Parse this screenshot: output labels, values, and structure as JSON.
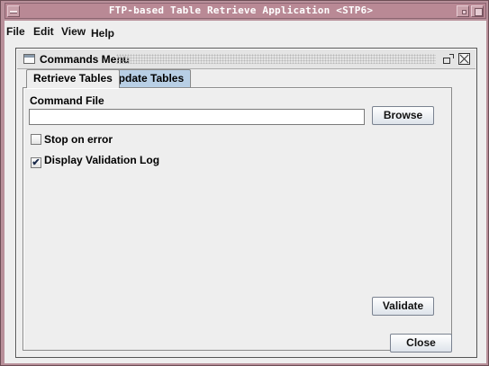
{
  "window": {
    "title": "FTP-based Table Retrieve Application <STP6>"
  },
  "menubar": {
    "items": [
      {
        "label": "File"
      },
      {
        "label": "Edit"
      },
      {
        "label": "View"
      },
      {
        "label": "Help"
      }
    ]
  },
  "internal_frame": {
    "title": "Commands Menu"
  },
  "tabs": [
    {
      "label": "Retrieve Tables",
      "selected": true
    },
    {
      "label": "Update Tables",
      "selected": false
    }
  ],
  "form": {
    "command_file_label": "Command File",
    "command_file_value": "",
    "browse_label": "Browse",
    "stop_on_error_label": "Stop on error",
    "stop_on_error_checked": false,
    "display_log_label": "Display Validation Log",
    "display_log_checked": true,
    "validate_label": "Validate"
  },
  "footer": {
    "close_label": "Close"
  },
  "colors": {
    "wm_frame": "#b8909a",
    "selected_tab_fill": "#eeeeee",
    "inactive_tab_fill": "#b8cfe5"
  },
  "icons": [
    "window-menu-icon",
    "minimize-icon",
    "maximize-icon",
    "frame-icon",
    "restore-icon",
    "close-icon",
    "checkmark-icon"
  ]
}
